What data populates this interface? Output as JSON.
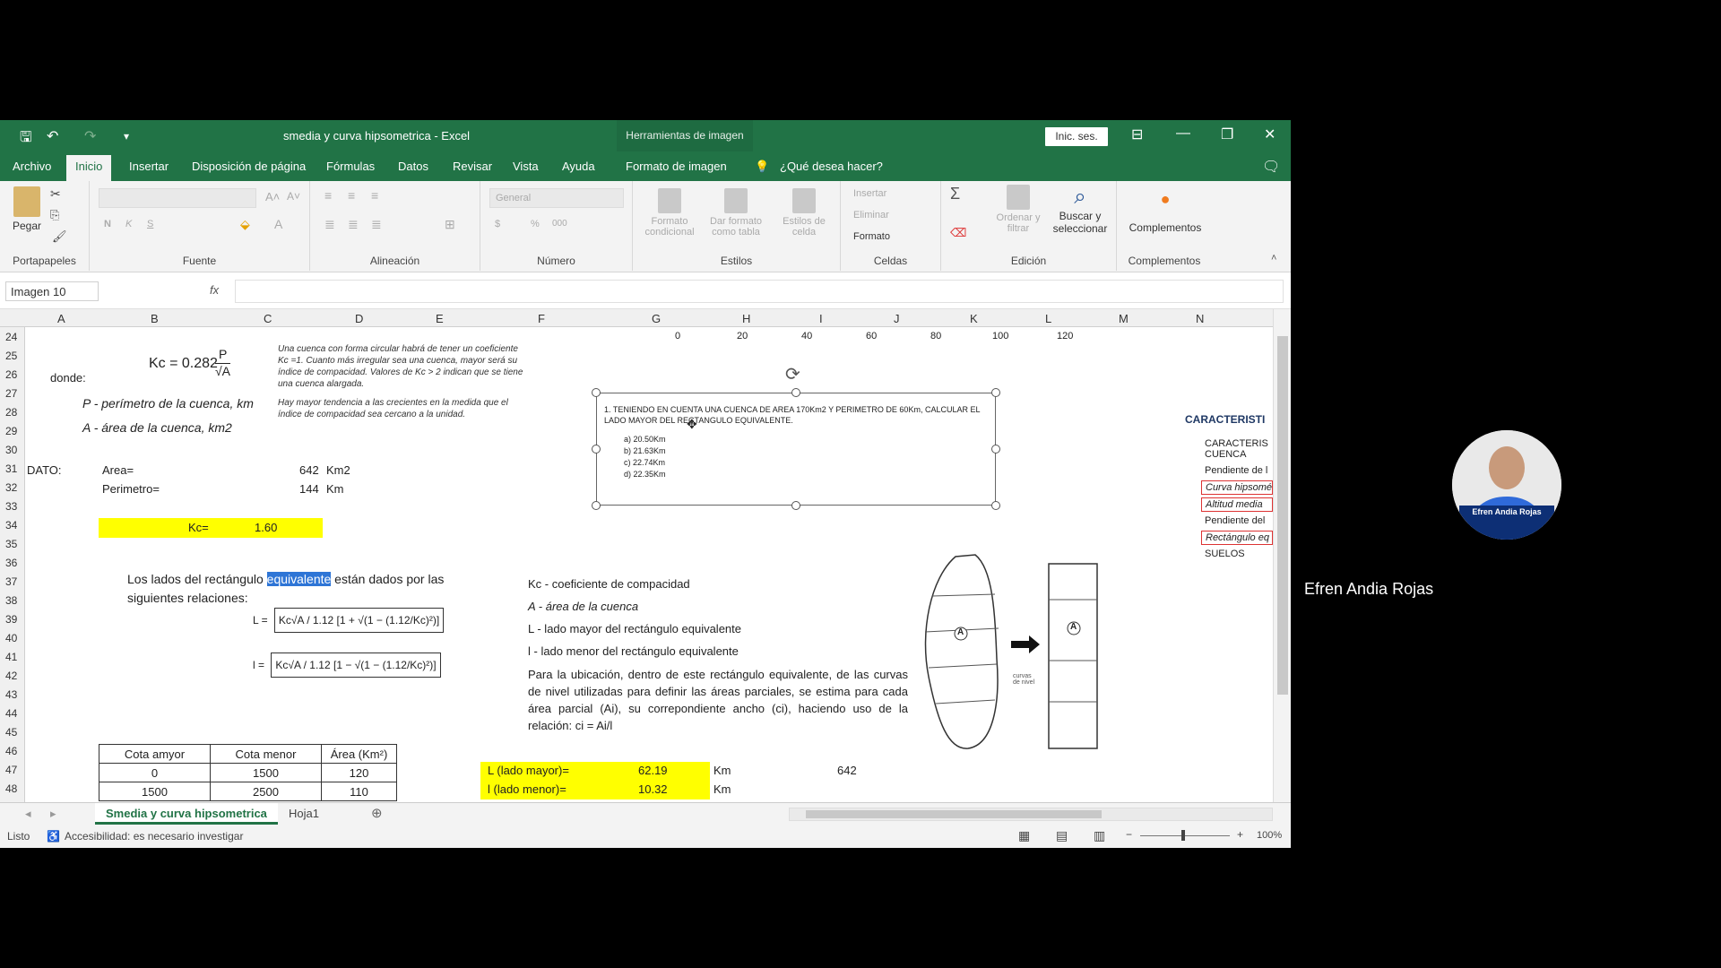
{
  "window": {
    "title": "smedia y curva hipsometrica  -  Excel",
    "context_tools": "Herramientas de imagen",
    "signin": "Inic. ses."
  },
  "tabs": [
    "Archivo",
    "Inicio",
    "Insertar",
    "Disposición de página",
    "Fórmulas",
    "Datos",
    "Revisar",
    "Vista",
    "Ayuda",
    "Formato de imagen",
    "¿Qué desea hacer?"
  ],
  "ribbon": {
    "pegar": "Pegar",
    "groups": [
      "Portapapeles",
      "Fuente",
      "Alineación",
      "Número",
      "Estilos",
      "Celdas",
      "Edición",
      "Complementos"
    ],
    "number_format": "General",
    "styles": [
      "Formato condicional",
      "Dar formato como tabla",
      "Estilos de celda"
    ],
    "cells": [
      "Insertar",
      "Eliminar",
      "Formato"
    ],
    "edit": [
      "Ordenar y filtrar",
      "Buscar y seleccionar"
    ],
    "complementos": "Complementos"
  },
  "namebox": "Imagen 10",
  "columns": [
    "A",
    "B",
    "C",
    "D",
    "E",
    "F",
    "G",
    "H",
    "I",
    "J",
    "K",
    "L",
    "M",
    "N"
  ],
  "rows": [
    "24",
    "25",
    "26",
    "27",
    "28",
    "29",
    "30",
    "31",
    "32",
    "33",
    "34",
    "35",
    "36",
    "37",
    "38",
    "39",
    "40",
    "41",
    "42",
    "43",
    "44",
    "45",
    "46",
    "47",
    "48"
  ],
  "sheet": {
    "kc_formula": "Kc = 0.282",
    "kc_num": "P",
    "kc_den": "√A",
    "donde": "donde:",
    "p_def": "P - perímetro de la cuenca, km",
    "a_def": "A - área de la cuenca, km2",
    "note1": "Una cuenca con forma circular habrá de tener un coeficiente Kc =1. Cuanto más irregular sea una cuenca, mayor será su índice de compacidad.  Valores de Kc > 2 indican que se tiene una cuenca alargada.",
    "note2": "Hay mayor tendencia a las crecientes en la medida que el índice de compacidad sea cercano a la unidad.",
    "dato": "DATO:",
    "area_label": "Area=",
    "area_value": "642",
    "area_unit": "Km2",
    "perim_label": "Perimetro=",
    "perim_value": "144",
    "perim_unit": "Km",
    "kc_label": "Kc=",
    "kc_value": "1.60",
    "lados_text_a": "Los lados del rectángulo ",
    "lados_highlight": "equivalente",
    "lados_text_b": " están dados por las",
    "lados_text_c": "siguientes relaciones:",
    "formula_L_lhs": "L =",
    "formula_L_frac": "Kc√A / 1.12",
    "formula_L_bracket": "1 + √(1 − (1.12/Kc)²)",
    "formula_l_lhs": "l =",
    "formula_l_frac": "Kc√A / 1.12",
    "formula_l_bracket": "1 − √(1 − (1.12/Kc)²)",
    "defs": [
      "Kc - coeficiente de compacidad",
      "A - área de la cuenca",
      "L - lado mayor del rectángulo equivalente",
      "l - lado menor del rectángulo equivalente"
    ],
    "ubicacion": "Para la ubicación, dentro de este rectángulo equivalente, de las curvas de nivel utilizadas para definir las áreas parciales, se estima para cada área parcial (Ai), su correpondiente ancho (ci), haciendo uso de la relación:  ci = Ai/l",
    "table_headers": [
      "Cota amyor",
      "Cota menor",
      "Área (Km²)"
    ],
    "table_rows": [
      [
        "0",
        "1500",
        "120"
      ],
      [
        "1500",
        "2500",
        "110"
      ]
    ],
    "L_label": "L (lado mayor)=",
    "L_value": "62.19",
    "L_unit": "Km",
    "l_label": "l (lado menor)=",
    "l_value": "10.32",
    "l_unit": "Km",
    "extra_value": "642",
    "axis_ticks": [
      "0",
      "20",
      "40",
      "60",
      "80",
      "100",
      "120"
    ],
    "side_title": "CARACTERISTI",
    "side_items": [
      "CARACTERIS CUENCA",
      "Pendiente de l",
      "Curva hipsomé",
      "Altitud media",
      "Pendiente del",
      "Rectángulo eq",
      "SUELOS"
    ],
    "diagram_label": "curvas de nivel",
    "diagram_A": "A"
  },
  "picture": {
    "question": "1.   TENIENDO EN CUENTA UNA CUENCA DE AREA 170Km2 Y PERIMETRO DE 60Km, CALCULAR EL LADO MAYOR DEL RECTANGULO EQUIVALENTE.",
    "options": [
      "a)   20.50Km",
      "b)   21.63Km",
      "c)   22.74Km",
      "d)   22.35Km"
    ]
  },
  "sheet_tabs": [
    "Smedia y curva hipsometrica",
    "Hoja1"
  ],
  "status": {
    "ready": "Listo",
    "accessibility": "Accesibilidad: es necesario investigar",
    "zoom": "100%"
  },
  "speaker": {
    "name": "Efren Andia Rojas",
    "badge": "Efren Andia Rojas"
  },
  "colors": {
    "excel_green": "#217346",
    "yellow": "#ffff00",
    "highlight": "#2e75d6"
  }
}
